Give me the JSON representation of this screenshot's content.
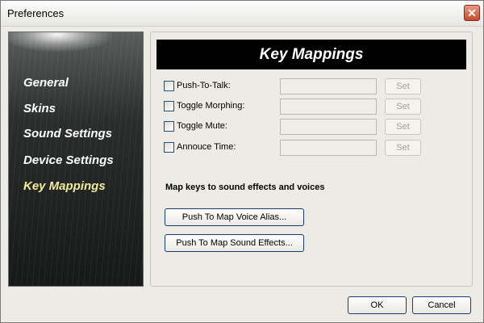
{
  "window": {
    "title": "Preferences",
    "close_icon": "close-icon"
  },
  "sidebar": {
    "items": [
      {
        "label": "General",
        "active": false
      },
      {
        "label": "Skins",
        "active": false
      },
      {
        "label": "Sound Settings",
        "active": false
      },
      {
        "label": "Device Settings",
        "active": false
      },
      {
        "label": "Key Mappings",
        "active": true
      }
    ]
  },
  "panel": {
    "header": "Key Mappings",
    "rows": [
      {
        "label": "Push-To-Talk:",
        "checked": false,
        "value": "",
        "button": "Set"
      },
      {
        "label": "Toggle Morphing:",
        "checked": false,
        "value": "",
        "button": "Set"
      },
      {
        "label": "Toggle Mute:",
        "checked": false,
        "value": "",
        "button": "Set"
      },
      {
        "label": "Annouce Time:",
        "checked": false,
        "value": "",
        "button": "Set"
      }
    ],
    "section_label": "Map keys to sound effects and voices",
    "map_voice_button": "Push To Map Voice Alias...",
    "map_sfx_button": "Push To Map Sound Effects..."
  },
  "footer": {
    "ok": "OK",
    "cancel": "Cancel"
  },
  "colors": {
    "active_nav": "#f2ec9a",
    "header_bg": "#000000",
    "close_button": "#c9492c"
  }
}
